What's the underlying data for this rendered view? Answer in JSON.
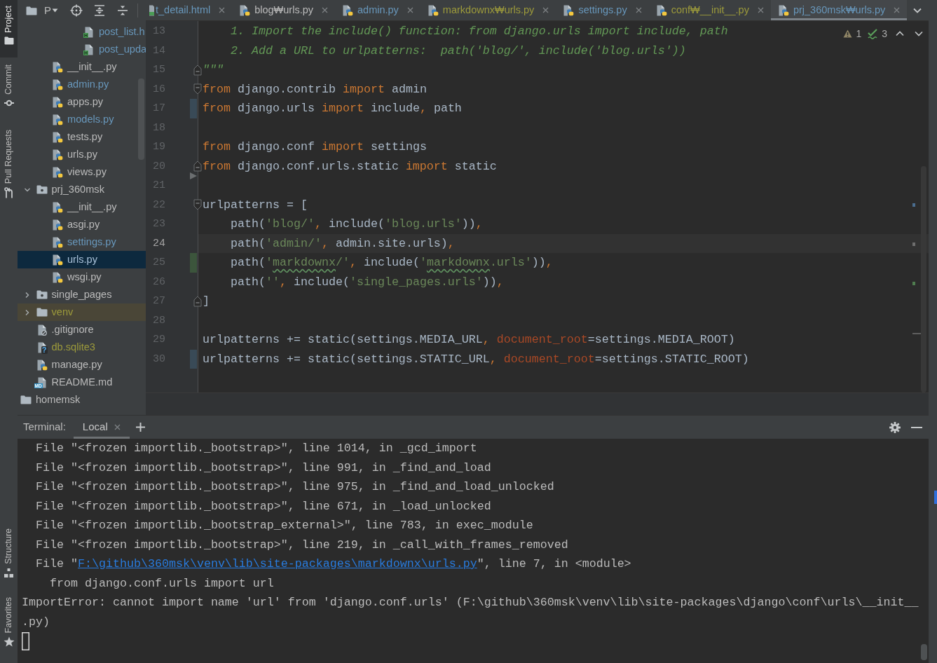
{
  "tool_windows": {
    "top": [
      {
        "label": "Project",
        "selected": true
      },
      {
        "label": "Commit",
        "selected": false
      },
      {
        "label": "Pull Requests",
        "selected": false
      }
    ],
    "bottom": [
      {
        "label": "Structure",
        "selected": false
      },
      {
        "label": "Favorites",
        "selected": false
      }
    ]
  },
  "project_panel": {
    "title": "P",
    "tree": [
      {
        "children": [
          {
            "children": [
              {
                "children": [
                  {
                    "children": [
                      {
                        "label": "post_list.h",
                        "kind": "html",
                        "badge": "H",
                        "color": "#6897bb",
                        "selected": false
                      },
                      {
                        "label": "post_upda",
                        "kind": "html",
                        "badge": "H",
                        "color": "#6897bb",
                        "selected": false
                      }
                    ]
                  }
                ]
              },
              {
                "label": "__init__.py",
                "kind": "python",
                "color": "#bbbbbb",
                "selected": false
              },
              {
                "label": "admin.py",
                "kind": "python",
                "color": "#6897bb",
                "selected": false
              },
              {
                "label": "apps.py",
                "kind": "python",
                "color": "#bbbbbb",
                "selected": false
              },
              {
                "label": "models.py",
                "kind": "python",
                "color": "#6897bb",
                "selected": false
              },
              {
                "label": "tests.py",
                "kind": "python",
                "color": "#bbbbbb",
                "selected": false
              },
              {
                "label": "urls.py",
                "kind": "python",
                "color": "#bbbbbb",
                "selected": false
              },
              {
                "label": "views.py",
                "kind": "python",
                "color": "#bbbbbb",
                "selected": false
              }
            ]
          },
          {
            "label": "prj_360msk",
            "kind": "package",
            "color": "#bbbbbb",
            "expanded": true,
            "excluded": false,
            "selected": false,
            "children": [
              {
                "label": "__init__.py",
                "kind": "python",
                "color": "#bbbbbb",
                "selected": false
              },
              {
                "label": "asgi.py",
                "kind": "python",
                "color": "#bbbbbb",
                "selected": false
              },
              {
                "label": "settings.py",
                "kind": "python",
                "color": "#6897bb",
                "selected": false
              },
              {
                "label": "urls.py",
                "kind": "python",
                "selected": true
              },
              {
                "label": "wsgi.py",
                "kind": "python",
                "color": "#bbbbbb",
                "selected": false
              }
            ]
          },
          {
            "label": "single_pages",
            "kind": "package",
            "color": "#bbbbbb",
            "expanded": false,
            "excluded": false,
            "selected": false
          },
          {
            "label": "venv",
            "kind": "folder",
            "color": "#9c9a3b",
            "expanded": false,
            "excluded": true,
            "selected": false
          },
          {
            "label": ".gitignore",
            "kind": "gitignore",
            "color": "#bbbbbb",
            "selected": false
          },
          {
            "label": "db.sqlite3",
            "kind": "unknown",
            "badge": "?",
            "color": "#9c9a3b",
            "selected": false
          },
          {
            "label": "manage.py",
            "kind": "python",
            "color": "#bbbbbb",
            "selected": false
          },
          {
            "label": "README.md",
            "kind": "markdown",
            "badge": "MD",
            "color": "#bbbbbb",
            "selected": false
          }
        ]
      },
      {
        "label": "homemsk",
        "kind": "folder",
        "color": "#bbbbbb",
        "excluded": false,
        "selected": false
      }
    ]
  },
  "editor": {
    "tabs": [
      {
        "label": "t_detail.html",
        "kind": "html",
        "color": "#6897bb",
        "selected": false
      },
      {
        "label": "blog₩urls.py",
        "kind": "python",
        "color": "#bbbbbb",
        "selected": false
      },
      {
        "label": "admin.py",
        "kind": "python",
        "color": "#6897bb",
        "selected": false
      },
      {
        "label": "markdownx₩urls.py",
        "kind": "python",
        "color": "#9c9a3b",
        "selected": false
      },
      {
        "label": "settings.py",
        "kind": "python",
        "color": "#6897bb",
        "selected": false
      },
      {
        "label": "conf₩__init__.py",
        "kind": "python",
        "color": "#9c9a3b",
        "selected": false
      },
      {
        "label": "prj_360msk₩urls.py",
        "kind": "python",
        "color": "#6897bb",
        "selected": true
      }
    ],
    "inspections": {
      "warnings": "1",
      "typos": "3"
    },
    "lines": [
      {
        "number": "13",
        "current": false,
        "tokens": [
          {
            "kind": "comment",
            "text": "    1. Import the include() function: from django.urls import include, path"
          }
        ]
      },
      {
        "number": "14",
        "current": false,
        "tokens": [
          {
            "kind": "comment",
            "text": "    2. Add a URL to urlpatterns:  path('blog/', include('blog.urls'))"
          }
        ]
      },
      {
        "number": "15",
        "current": false,
        "marker": {
          "kind": "fold_end"
        },
        "tokens": [
          {
            "kind": "comment",
            "text": "\"\"\""
          }
        ]
      },
      {
        "number": "16",
        "current": false,
        "marker": {
          "kind": "fold_start"
        },
        "tokens": [
          {
            "kind": "keyword",
            "text": "from"
          },
          {
            "kind": "plain",
            "text": " django.contrib "
          },
          {
            "kind": "keyword",
            "text": "import"
          },
          {
            "kind": "plain",
            "text": " admin"
          }
        ]
      },
      {
        "number": "17",
        "current": false,
        "marker": {
          "kind": "modified"
        },
        "tokens": [
          {
            "kind": "keyword",
            "text": "from"
          },
          {
            "kind": "plain",
            "text": " django.urls "
          },
          {
            "kind": "keyword",
            "text": "import"
          },
          {
            "kind": "plain",
            "text": " include"
          },
          {
            "kind": "punct",
            "text": ","
          },
          {
            "kind": "plain",
            "text": " path"
          }
        ]
      },
      {
        "number": "18",
        "current": false
      },
      {
        "number": "19",
        "current": false,
        "tokens": [
          {
            "kind": "keyword",
            "text": "from"
          },
          {
            "kind": "plain",
            "text": " django.conf "
          },
          {
            "kind": "keyword",
            "text": "import"
          },
          {
            "kind": "plain",
            "text": " settings"
          }
        ]
      },
      {
        "number": "20",
        "current": false,
        "marker": {
          "kind": "fold_end"
        },
        "tokens": [
          {
            "kind": "keyword",
            "text": "from"
          },
          {
            "kind": "plain",
            "text": " django.conf.urls.static "
          },
          {
            "kind": "keyword",
            "text": "import"
          },
          {
            "kind": "plain",
            "text": " static"
          }
        ]
      },
      {
        "number": "21",
        "current": false,
        "marker": {
          "kind": "deleted"
        }
      },
      {
        "number": "22",
        "current": false,
        "marker": {
          "kind": "fold_start"
        },
        "tokens": [
          {
            "kind": "plain",
            "text": "urlpatterns = ["
          }
        ]
      },
      {
        "number": "23",
        "current": false,
        "tokens": [
          {
            "kind": "plain",
            "text": "    path("
          },
          {
            "kind": "string",
            "text": "'blog/'"
          },
          {
            "kind": "punct",
            "text": ","
          },
          {
            "kind": "plain",
            "text": " include("
          },
          {
            "kind": "string",
            "text": "'blog.urls'"
          },
          {
            "kind": "plain",
            "text": "))"
          },
          {
            "kind": "punct",
            "text": ","
          }
        ]
      },
      {
        "number": "24",
        "current": true,
        "tokens": [
          {
            "kind": "plain",
            "text": "    path("
          },
          {
            "kind": "string",
            "text": "'admin/'"
          },
          {
            "kind": "punct",
            "text": ","
          },
          {
            "kind": "plain",
            "text": " admin.site.urls)"
          },
          {
            "kind": "punct",
            "text": ","
          }
        ]
      },
      {
        "number": "25",
        "current": false,
        "marker": {
          "kind": "added"
        },
        "tokens": [
          {
            "kind": "plain",
            "text": "    path("
          },
          {
            "kind": "string",
            "text": "'"
          },
          {
            "kind": "typo",
            "text": "markdownx"
          },
          {
            "kind": "string",
            "text": "/'"
          },
          {
            "kind": "punct",
            "text": ","
          },
          {
            "kind": "plain",
            "text": " include("
          },
          {
            "kind": "string",
            "text": "'"
          },
          {
            "kind": "typo",
            "text": "markdownx"
          },
          {
            "kind": "string",
            "text": ".urls'"
          },
          {
            "kind": "plain",
            "text": "))"
          },
          {
            "kind": "punct",
            "text": ","
          }
        ]
      },
      {
        "number": "26",
        "current": false,
        "tokens": [
          {
            "kind": "plain",
            "text": "    path("
          },
          {
            "kind": "string",
            "text": "''"
          },
          {
            "kind": "punct",
            "text": ","
          },
          {
            "kind": "plain",
            "text": " include("
          },
          {
            "kind": "string",
            "text": "'single_pages.urls'"
          },
          {
            "kind": "plain",
            "text": "))"
          },
          {
            "kind": "punct",
            "text": ","
          }
        ]
      },
      {
        "number": "27",
        "current": false,
        "marker": {
          "kind": "fold_end"
        },
        "tokens": [
          {
            "kind": "plain",
            "text": "]"
          }
        ]
      },
      {
        "number": "28",
        "current": false
      },
      {
        "number": "29",
        "current": false,
        "tokens": [
          {
            "kind": "plain",
            "text": "urlpatterns += static(settings.MEDIA_URL"
          },
          {
            "kind": "punct",
            "text": ", "
          },
          {
            "kind": "param",
            "text": "document_root"
          },
          {
            "kind": "plain",
            "text": "=settings.MEDIA_ROOT)"
          }
        ]
      },
      {
        "number": "30",
        "current": false,
        "marker": {
          "kind": "modified"
        },
        "tokens": [
          {
            "kind": "plain",
            "text": "urlpatterns += static(settings.STATIC_URL"
          },
          {
            "kind": "punct",
            "text": ", "
          },
          {
            "kind": "param",
            "text": "document_root"
          },
          {
            "kind": "plain",
            "text": "=settings.STATIC_ROOT)"
          }
        ]
      }
    ]
  },
  "terminal": {
    "title": "Terminal:",
    "tabs": [
      {
        "label": "Local",
        "selected": true
      }
    ],
    "lines": [
      {
        "tokens": [
          {
            "kind": "plain",
            "text": "  File \"<frozen importlib._bootstrap>\", line 1014, in _gcd_import"
          }
        ]
      },
      {
        "tokens": [
          {
            "kind": "plain",
            "text": "  File \"<frozen importlib._bootstrap>\", line 991, in _find_and_load"
          }
        ]
      },
      {
        "tokens": [
          {
            "kind": "plain",
            "text": "  File \"<frozen importlib._bootstrap>\", line 975, in _find_and_load_unlocked"
          }
        ]
      },
      {
        "tokens": [
          {
            "kind": "plain",
            "text": "  File \"<frozen importlib._bootstrap>\", line 671, in _load_unlocked"
          }
        ]
      },
      {
        "tokens": [
          {
            "kind": "plain",
            "text": "  File \"<frozen importlib._bootstrap_external>\", line 783, in exec_module"
          }
        ]
      },
      {
        "tokens": [
          {
            "kind": "plain",
            "text": "  File \"<frozen importlib._bootstrap>\", line 219, in _call_with_frames_removed"
          }
        ]
      },
      {
        "tokens": [
          {
            "kind": "plain",
            "text": "  File \""
          },
          {
            "kind": "link",
            "text": "F:\\github\\360msk\\venv\\lib\\site-packages\\markdownx\\urls.py"
          },
          {
            "kind": "plain",
            "text": "\", line 7, in <module>"
          }
        ]
      },
      {
        "tokens": [
          {
            "kind": "plain",
            "text": "    from django.conf.urls import url"
          }
        ]
      },
      {
        "tokens": [
          {
            "kind": "plain",
            "text": "ImportError: cannot import name 'url' from 'django.conf.urls' (F:\\github\\360msk\\venv\\lib\\site-packages\\django\\conf\\urls\\__init__"
          }
        ]
      },
      {
        "tokens": [
          {
            "kind": "plain",
            "text": ".py)"
          }
        ]
      }
    ],
    "cursor": true
  }
}
